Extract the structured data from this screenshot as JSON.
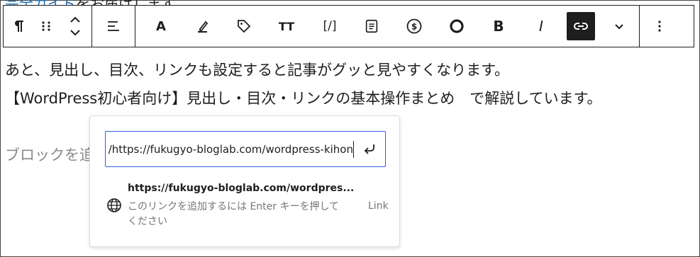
{
  "top_partial": {
    "link_text": "完全ガイド",
    "rest_text": "をお届けします。"
  },
  "toolbar": {
    "paragraph_icon": "pilcrow-icon",
    "drag_icon": "drag-handle-icon",
    "move_icon": "move-up-down-icon",
    "align_icon": "align-icon",
    "font_label": "A",
    "highlight_icon": "highlighter-icon",
    "tag_icon": "tag-icon",
    "text_size_label": "TT",
    "shortcode_label": "[/]",
    "form_icon": "form-icon",
    "dollar_icon": "dollar-circle-icon",
    "circle_icon": "circle-icon",
    "bold_label": "B",
    "italic_label": "I",
    "link_icon": "link-icon",
    "more_icon": "chevron-down-icon",
    "options_icon": "more-vertical-icon"
  },
  "content": {
    "paragraph1": "あと、見出し、目次、リンクも設定すると記事がグッと見やすくなります。",
    "paragraph2": "【WordPress初心者向け】見出し・目次・リンクの基本操作まとめ　で解説しています。",
    "placeholder": "ブロックを追"
  },
  "link_popover": {
    "url_value": "https://fukugyo-bloglab.com/wordpress-kihon/",
    "submit_icon": "enter-return-icon",
    "suggestion": {
      "title": "https://fukugyo-bloglab.com/wordpres...",
      "info": "このリンクを追加するには Enter キーを押してください",
      "type": "Link",
      "icon": "globe-icon"
    }
  }
}
